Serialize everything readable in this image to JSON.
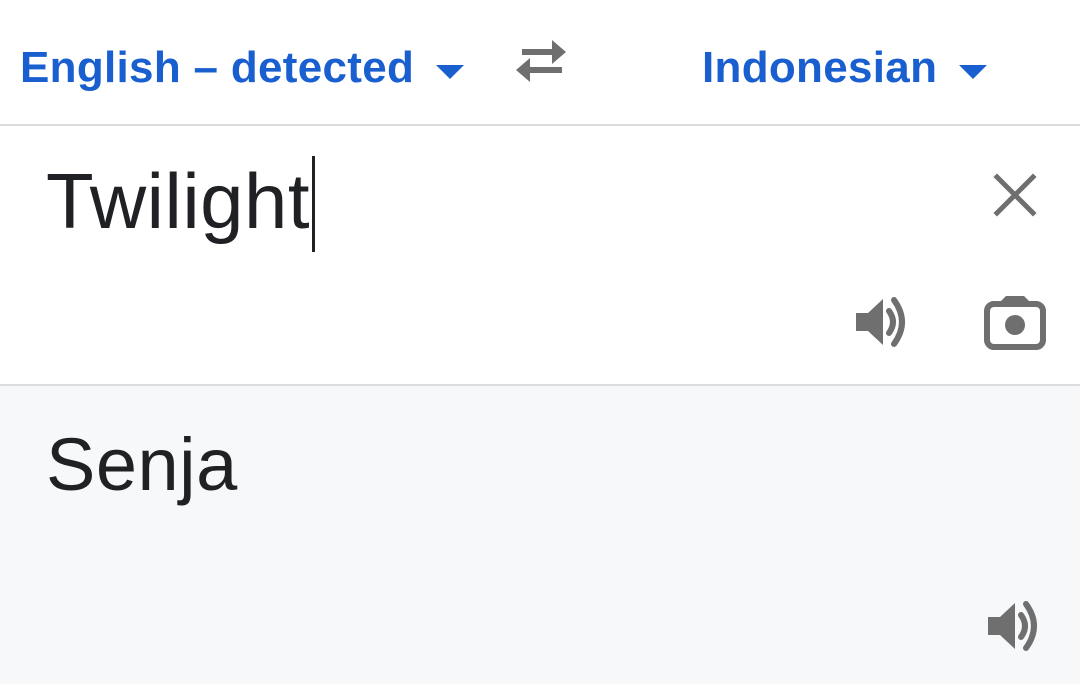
{
  "languages": {
    "source_label": "English – detected",
    "target_label": "Indonesian",
    "swap_icon": "swap-arrows-icon",
    "dropdown_icon": "caret-down-icon"
  },
  "source": {
    "text": "Twilight",
    "clear_icon": "close-icon",
    "speak_icon": "volume-icon",
    "camera_icon": "camera-icon"
  },
  "result": {
    "text": "Senja",
    "speak_icon": "volume-icon"
  },
  "colors": {
    "accent": "#1a5fcf",
    "text": "#202124",
    "icon": "#6f6f6f",
    "divider": "#dadce0",
    "result_background": "#f7f8fa"
  }
}
